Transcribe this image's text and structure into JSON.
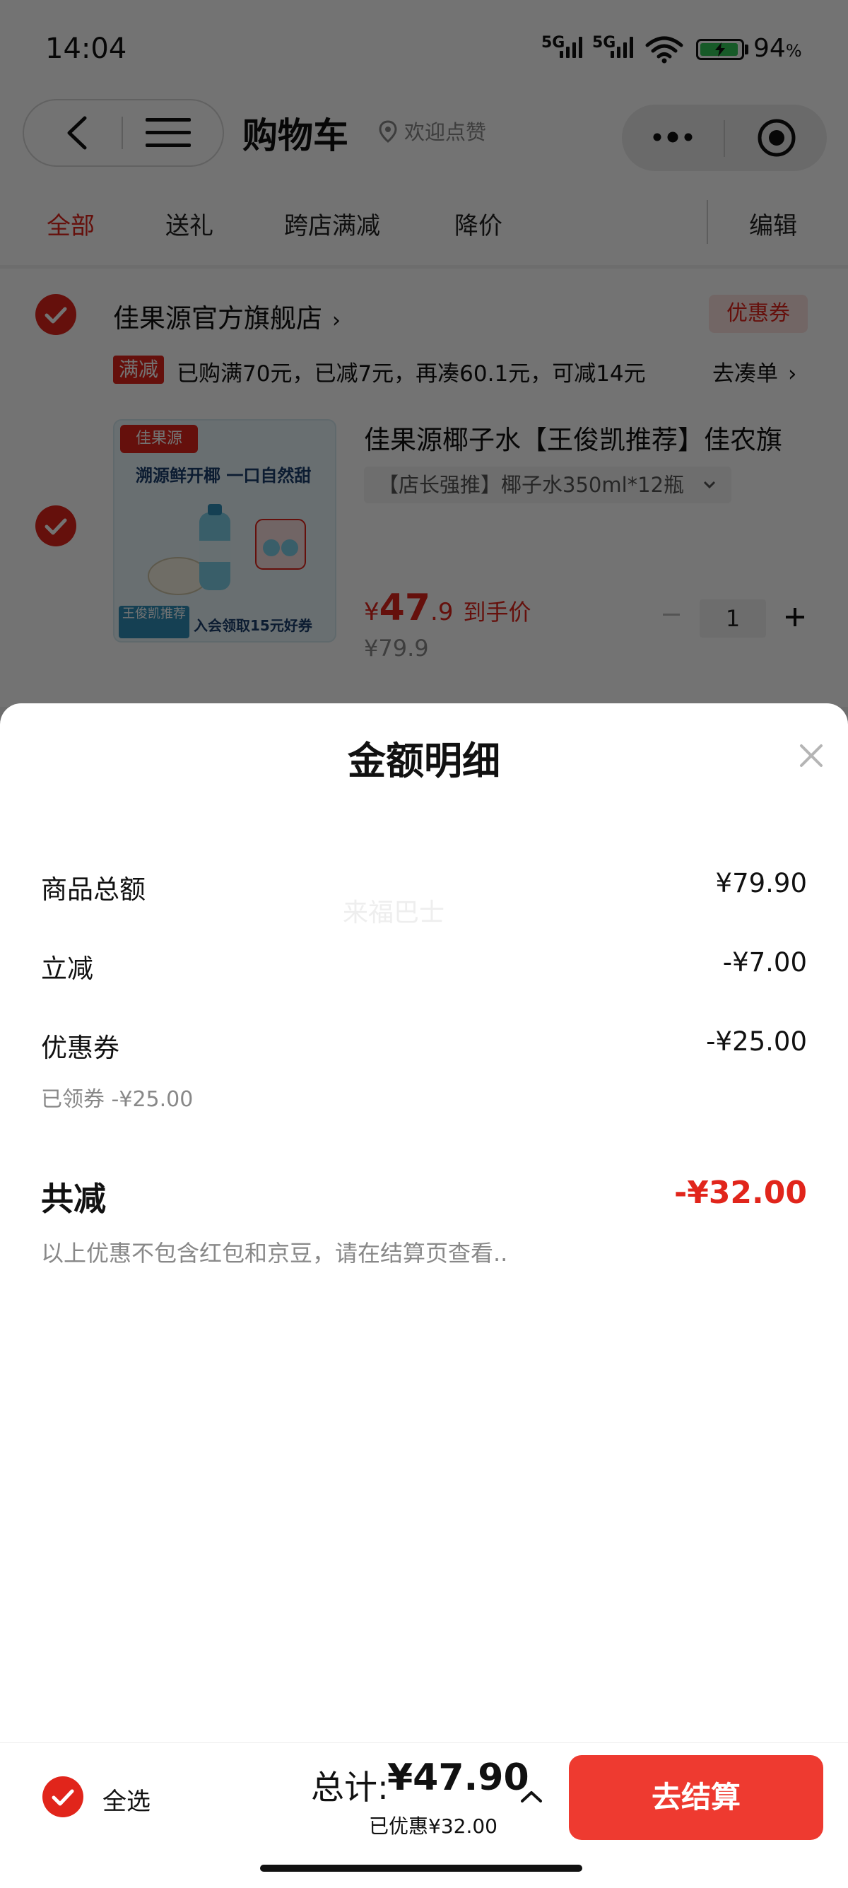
{
  "status_bar": {
    "time": "14:04",
    "signal_labels": [
      "5G",
      "5G"
    ],
    "battery_percent": "94",
    "battery_unit": "%",
    "battery_level": 0.94
  },
  "header": {
    "title": "购物车",
    "welcome": "欢迎点赞"
  },
  "tabs": {
    "items": [
      "全部",
      "送礼",
      "跨店满减",
      "降价"
    ],
    "active_index": 0,
    "edit": "编辑"
  },
  "cart": {
    "store_name": "佳果源官方旗舰店",
    "coupon_tag": "优惠券",
    "promo_tag": "满减",
    "promo_text": "已购满70元，已减7元，再凑60.1元，可减14元",
    "promo_link": "去凑单",
    "product": {
      "title": "佳果源椰子水【王俊凯推荐】佳农旗",
      "spec": "【店长强推】椰子水350ml*12瓶",
      "price_symbol": "¥",
      "price_int": "47",
      "price_dec": ".9",
      "price_tag": "到手价",
      "original_price": "¥79.9",
      "quantity": "1",
      "image_text": {
        "brand": "佳果源",
        "slogan": "溯源鲜开椰 一口自然甜",
        "badge": "王俊凯推荐",
        "coupon_text": "入会领取15元好券"
      }
    }
  },
  "sheet": {
    "title": "金额明细",
    "rows": [
      {
        "label": "商品总额",
        "value": "¥79.90"
      },
      {
        "label": "立减",
        "value": "-¥7.00"
      },
      {
        "label": "优惠券",
        "value": "-¥25.00"
      }
    ],
    "coupon_note": "已领券 -¥25.00",
    "total_label": "共减",
    "total_value": "-¥32.00",
    "disclaimer": "以上优惠不包含红包和京豆，请在结算页查看..",
    "watermark": "来福巴士"
  },
  "bottom_bar": {
    "select_all": "全选",
    "total_label": "总计:",
    "total_value": "¥47.90",
    "saved": "已优惠¥32.00",
    "checkout": "去结算"
  },
  "colors": {
    "accent": "#e1251b",
    "checkout": "#ee3a30"
  }
}
